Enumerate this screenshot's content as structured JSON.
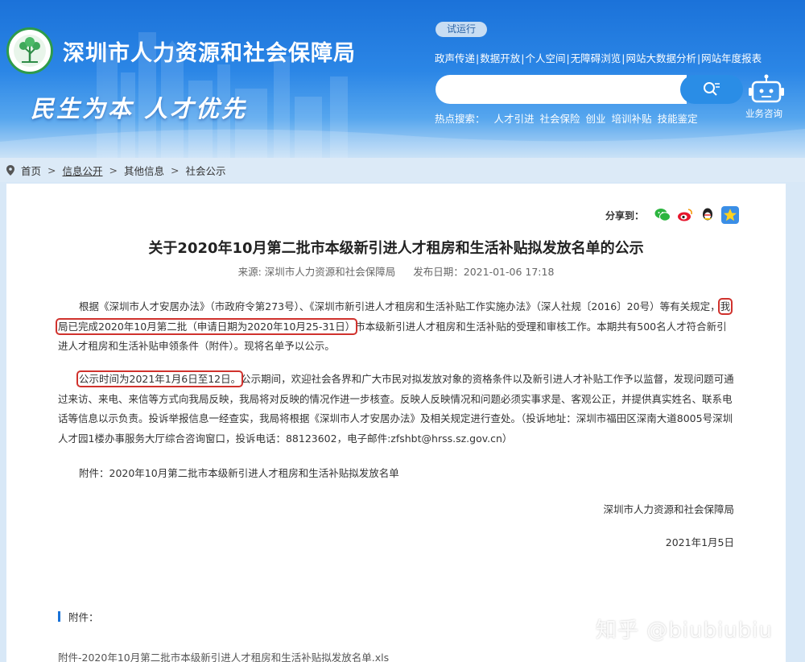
{
  "header": {
    "org_title": "深圳市人力资源和社会保障局",
    "slogan": "民生为本  人才优先",
    "trial_badge": "试运行",
    "topnav": [
      "政声传递",
      "数据开放",
      "个人空间",
      "无障碍浏览",
      "网站大数据分析",
      "网站年度报表"
    ],
    "search_placeholder": "",
    "hot_label": "热点搜索：",
    "hot_words": [
      "人才引进",
      "社会保险",
      "创业",
      "培训补贴",
      "技能鉴定"
    ],
    "service_label": "业务咨询"
  },
  "breadcrumb": {
    "items": [
      "首页",
      "信息公开",
      "其他信息",
      "社会公示"
    ],
    "separator": ">"
  },
  "article": {
    "share_label": "分享到：",
    "title": "关于2020年10月第二批市本级新引进人才租房和生活补贴拟发放名单的公示",
    "source": "来源: 深圳市人力资源和社会保障局",
    "publish_date": "发布日期：2021-01-06 17:18",
    "p1_a": "根据《深圳市人才安居办法》（市政府令第273号）、《深圳市新引进人才租房和生活补贴工作实施办法》（深人社规〔2016〕20号）等有关规定，",
    "p1_hl": "我局已完成2020年10月第二批（申请日期为2020年10月25-31日）",
    "p1_b": "市本级新引进人才租房和生活补贴的受理和审核工作。本期共有500名人才符合新引进人才租房和生活补贴申领条件（附件）。现将名单予以公示。",
    "p2_hl": "公示时间为2021年1月6日至12日。",
    "p2_b": "公示期间，欢迎社会各界和广大市民对拟发放对象的资格条件以及新引进人才补贴工作予以监督，发现问题可通过来访、来电、来信等方式向我局反映，我局将对反映的情况作进一步核查。反映人反映情况和问题必须实事求是、客观公正，并提供真实姓名、联系电话等信息以示负责。投诉举报信息一经查实，我局将根据《深圳市人才安居办法》及相关规定进行查处。（投诉地址：深圳市福田区深南大道8005号深圳人才园1楼办事服务大厅综合咨询窗口，投诉电话：88123602，电子邮件:zfshbt@hrss.sz.gov.cn）",
    "attachment_line": "附件：2020年10月第二批市本级新引进人才租房和生活补贴拟发放名单",
    "signature": "深圳市人力资源和社会保障局",
    "sign_date": "2021年1月5日",
    "attach_head": "附件：",
    "attach_file": "附件-2020年10月第二批市本级新引进人才租房和生活补贴拟发放名单.xls"
  },
  "watermark": "知乎 @biubiubiu",
  "colors": {
    "header_blue": "#1b72d9",
    "highlight_red": "#d0322d",
    "accent_blue": "#1a73d8"
  }
}
